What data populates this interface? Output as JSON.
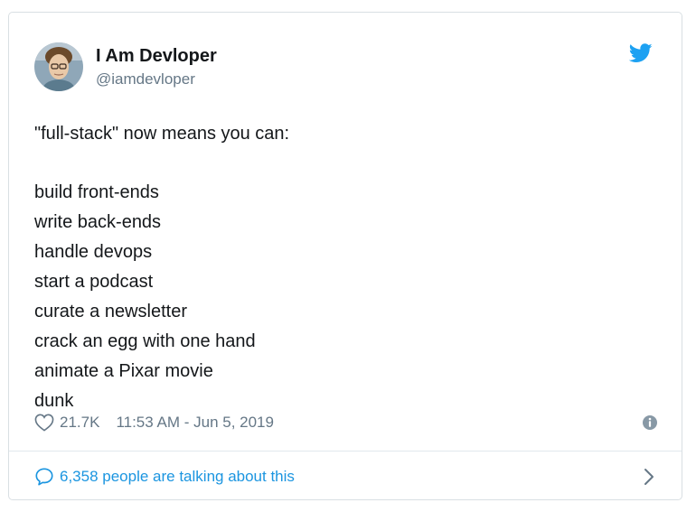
{
  "author": {
    "display_name": "I Am Devloper",
    "handle": "@iamdevloper",
    "avatar_icon": "profile-photo"
  },
  "tweet": {
    "intro": "\"full-stack\" now means you can:",
    "lines": [
      "build front-ends",
      "write back-ends",
      "handle devops",
      "start a podcast",
      "curate a newsletter",
      "crack an egg with one hand",
      "animate a Pixar movie",
      "dunk"
    ]
  },
  "meta": {
    "like_count": "21.7K",
    "timestamp": "11:53 AM - Jun 5, 2019"
  },
  "footer": {
    "talking_text": "6,358 people are talking about this"
  },
  "icons": {
    "brand": "twitter-bird-icon",
    "like": "heart-icon",
    "info": "info-icon",
    "reply": "speech-bubble-icon",
    "next": "chevron-right-icon"
  },
  "colors": {
    "brand_blue": "#1da1f2",
    "link_blue": "#1b95e0",
    "text": "#14171a",
    "muted": "#657786"
  }
}
